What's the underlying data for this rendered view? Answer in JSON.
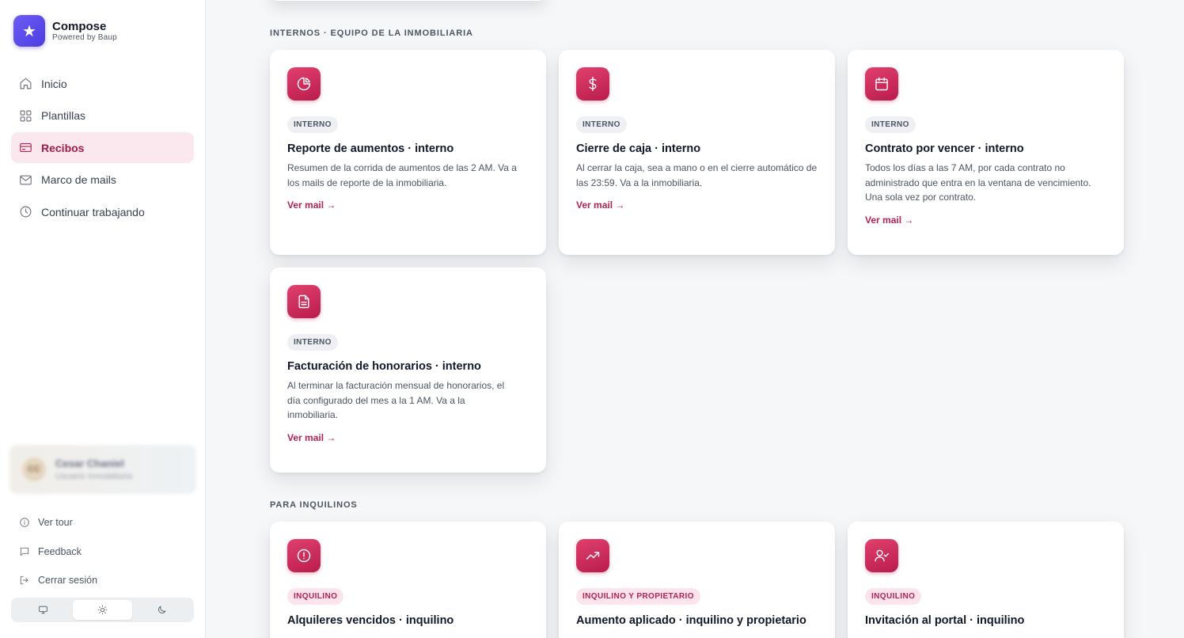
{
  "brand": {
    "name": "Compose",
    "subtitle": "Powered by Baup",
    "logo_icon": "star-icon"
  },
  "nav": {
    "items": [
      {
        "label": "Inicio",
        "icon": "home-icon"
      },
      {
        "label": "Plantillas",
        "icon": "grid-icon"
      },
      {
        "label": "Recibos",
        "icon": "receipt-icon",
        "active": true
      },
      {
        "label": "Marco de mails",
        "icon": "mail-icon"
      },
      {
        "label": "Continuar trabajando",
        "icon": "clock-icon"
      }
    ]
  },
  "user": {
    "initials": "CC",
    "name": "Cesar Chaniel",
    "role": "Usuario Inmobiliaria"
  },
  "footer": {
    "tour": "Ver tour",
    "feedback": "Feedback",
    "logout": "Cerrar sesión"
  },
  "theme": {
    "options": [
      "monitor-icon",
      "sun-icon",
      "moon-icon"
    ],
    "selected": "sun-icon"
  },
  "sections": {
    "internal": {
      "title": "INTERNOS · EQUIPO DE LA INMOBILIARIA",
      "cards": [
        {
          "icon": "pie-chart-icon",
          "badge": "INTERNO",
          "title": "Reporte de aumentos · interno",
          "desc": "Resumen de la corrida de aumentos de las 2 AM. Va a los mails de reporte de la inmobiliaria.",
          "link": "Ver mail →"
        },
        {
          "icon": "dollar-icon",
          "badge": "INTERNO",
          "title": "Cierre de caja · interno",
          "desc": "Al cerrar la caja, sea a mano o en el cierre automático de las 23:59. Va a la inmobiliaria.",
          "link": "Ver mail →"
        },
        {
          "icon": "calendar-icon",
          "badge": "INTERNO",
          "title": "Contrato por vencer · interno",
          "desc": "Todos los días a las 7 AM, por cada contrato no administrado que entra en la ventana de vencimiento. Una sola vez por contrato.",
          "link": "Ver mail →"
        },
        {
          "icon": "document-icon",
          "badge": "INTERNO",
          "title": "Facturación de honorarios · interno",
          "desc": "Al terminar la facturación mensual de honorarios, el día configurado del mes a la 1 AM. Va a la inmobiliaria.",
          "link": "Ver mail →"
        }
      ]
    },
    "tenants": {
      "title": "PARA INQUILINOS",
      "cards": [
        {
          "icon": "alert-circle-icon",
          "badge": "INQUILINO",
          "title": "Alquileres vencidos · inquilino"
        },
        {
          "icon": "trending-up-icon",
          "badge": "INQUILINO Y PROPIETARIO",
          "title": "Aumento aplicado · inquilino y propietario"
        },
        {
          "icon": "user-check-icon",
          "badge": "INQUILINO",
          "title": "Invitación al portal · inquilino"
        }
      ]
    }
  }
}
